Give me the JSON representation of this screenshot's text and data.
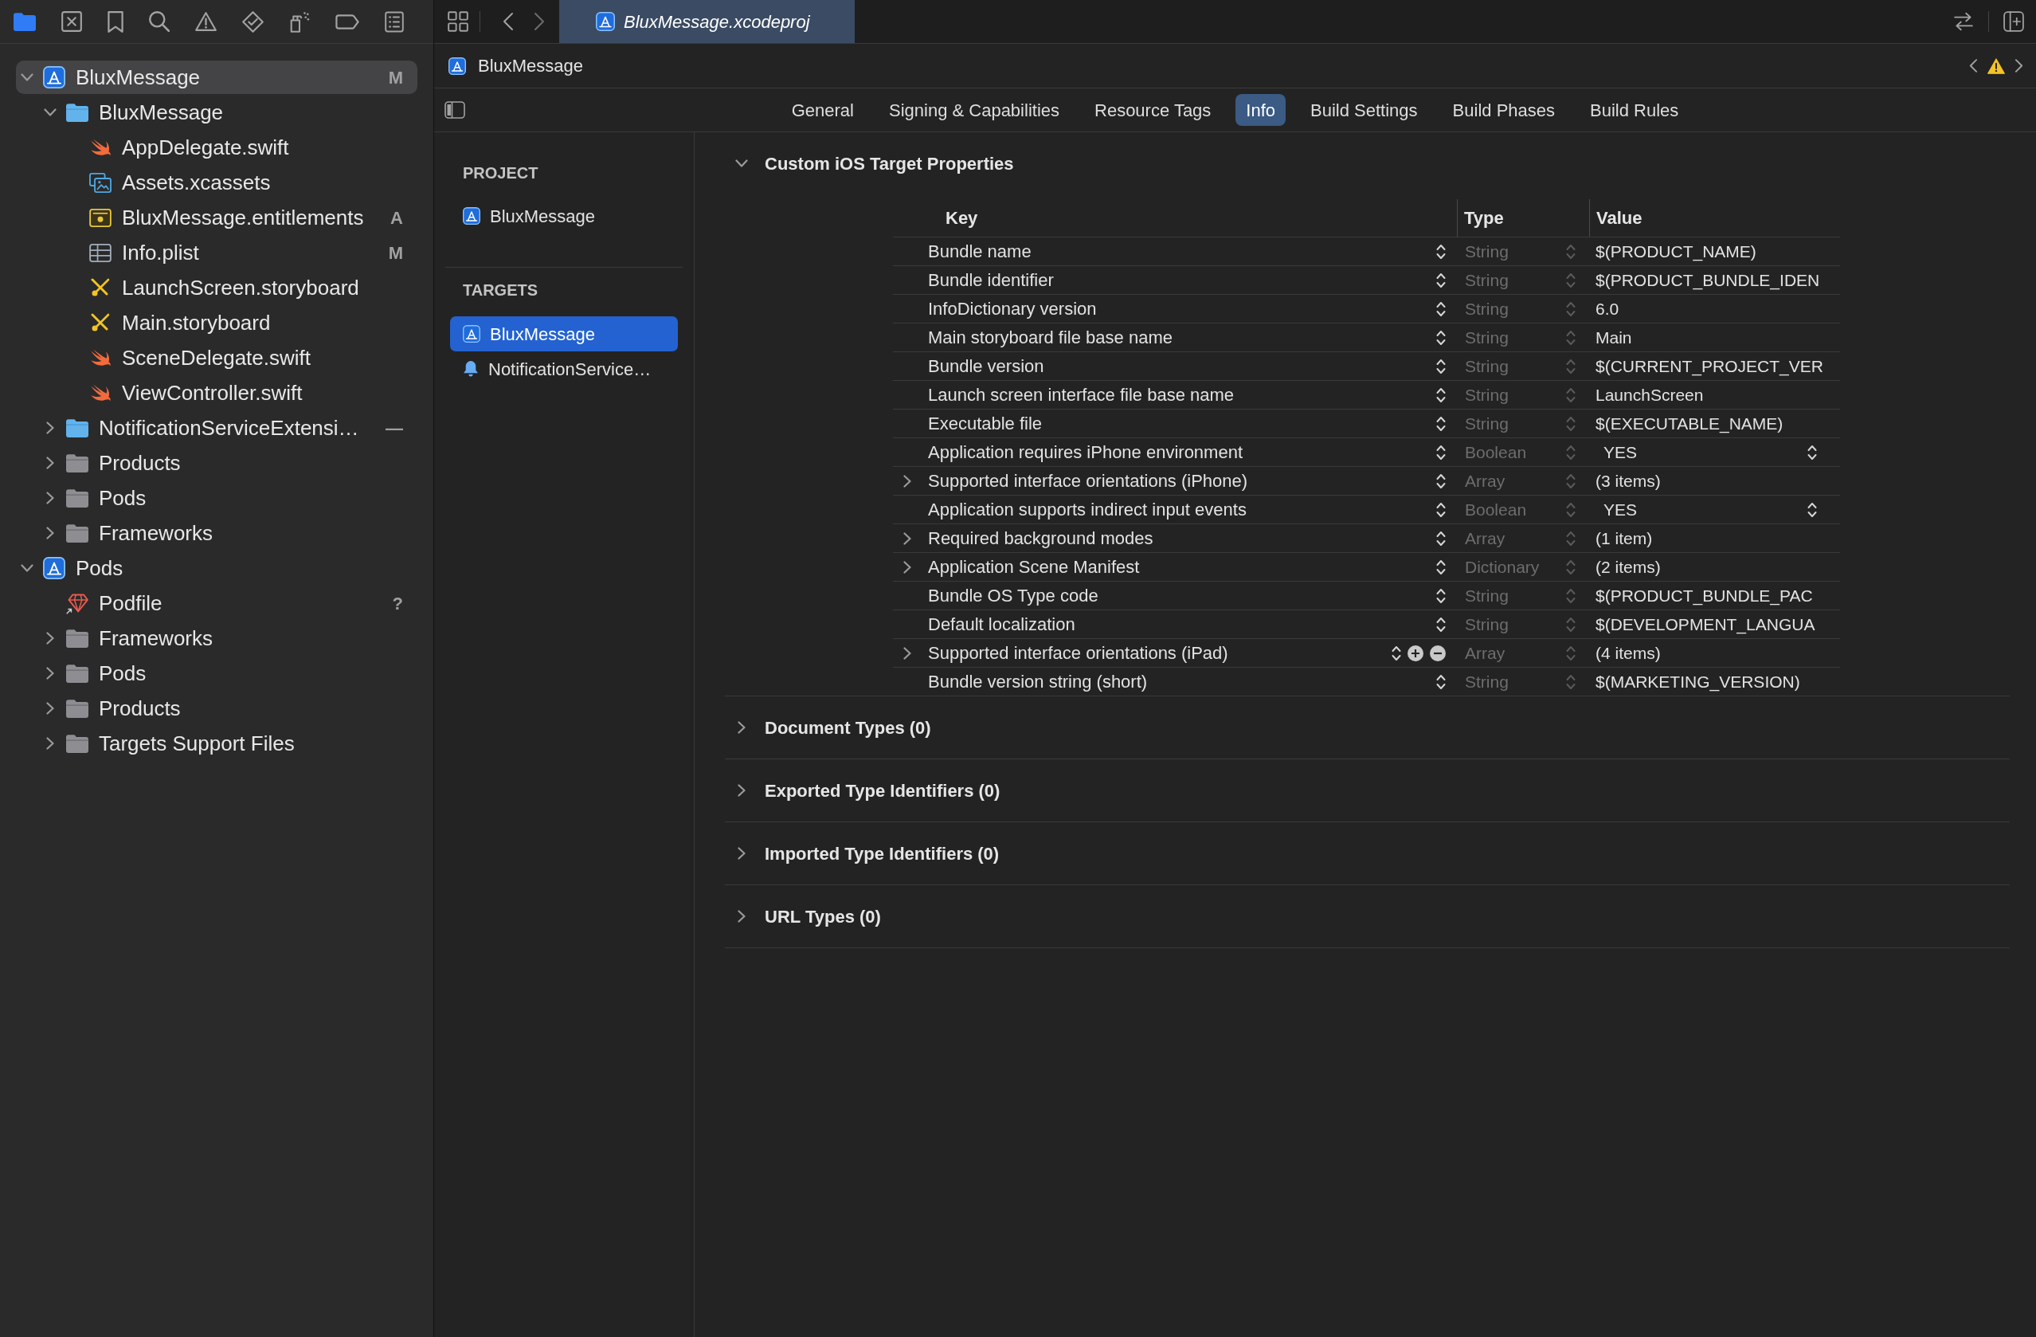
{
  "navigator": {
    "toolbar_tabs": [
      {
        "selected": true
      },
      {
        "selected": false
      },
      {
        "selected": false
      },
      {
        "selected": false
      },
      {
        "selected": false
      },
      {
        "selected": false
      },
      {
        "selected": false
      },
      {
        "selected": false
      },
      {
        "selected": false
      }
    ],
    "items": [
      {
        "label": "BluxMessage",
        "kind": "project",
        "expanded": true,
        "selected": true,
        "badge": "M",
        "children": [
          {
            "label": "BluxMessage",
            "kind": "folder",
            "expanded": true,
            "selected": false,
            "children": [
              {
                "label": "AppDelegate.swift",
                "kind": "swift",
                "selected": false
              },
              {
                "label": "Assets.xcassets",
                "kind": "assets",
                "selected": false
              },
              {
                "label": "BluxMessage.entitlements",
                "kind": "entitlements",
                "selected": false,
                "badge": "A"
              },
              {
                "label": "Info.plist",
                "kind": "plist",
                "selected": false,
                "badge": "M"
              },
              {
                "label": "LaunchScreen.storyboard",
                "kind": "storyboard",
                "selected": false
              },
              {
                "label": "Main.storyboard",
                "kind": "storyboard",
                "selected": false
              },
              {
                "label": "SceneDelegate.swift",
                "kind": "swift",
                "selected": false
              },
              {
                "label": "ViewController.swift",
                "kind": "swift",
                "selected": false
              }
            ]
          },
          {
            "label": "NotificationServiceExtensi…",
            "kind": "folder",
            "expanded": false,
            "selected": false,
            "badge": "—"
          },
          {
            "label": "Products",
            "kind": "group",
            "expanded": false,
            "selected": false
          },
          {
            "label": "Pods",
            "kind": "group",
            "expanded": false,
            "selected": false
          },
          {
            "label": "Frameworks",
            "kind": "group",
            "expanded": false,
            "selected": false
          }
        ]
      },
      {
        "label": "Pods",
        "kind": "project",
        "expanded": true,
        "selected": false,
        "children": [
          {
            "label": "Podfile",
            "kind": "gem",
            "selected": false,
            "badge": "?"
          },
          {
            "label": "Frameworks",
            "kind": "group",
            "expanded": false,
            "selected": false
          },
          {
            "label": "Pods",
            "kind": "group",
            "expanded": false,
            "selected": false
          },
          {
            "label": "Products",
            "kind": "group",
            "expanded": false,
            "selected": false
          },
          {
            "label": "Targets Support Files",
            "kind": "group",
            "expanded": false,
            "selected": false
          }
        ]
      }
    ]
  },
  "editor": {
    "tabs": [
      {
        "label": "BluxMessage.xcodeproj",
        "selected": true
      }
    ],
    "jump_bar": {
      "path": "BluxMessage"
    },
    "settings_tabs": [
      {
        "label": "General",
        "selected": false
      },
      {
        "label": "Signing & Capabilities",
        "selected": false
      },
      {
        "label": "Resource Tags",
        "selected": false
      },
      {
        "label": "Info",
        "selected": true
      },
      {
        "label": "Build Settings",
        "selected": false
      },
      {
        "label": "Build Phases",
        "selected": false
      },
      {
        "label": "Build Rules",
        "selected": false
      }
    ],
    "target_list": {
      "groups": [
        {
          "heading": "PROJECT",
          "items": [
            {
              "label": "BluxMessage",
              "kind": "app",
              "selected": false
            }
          ]
        },
        {
          "heading": "TARGETS",
          "items": [
            {
              "label": "BluxMessage",
              "kind": "app",
              "selected": true
            },
            {
              "label": "NotificationService…",
              "kind": "extension",
              "selected": false
            }
          ]
        }
      ]
    },
    "sections": [
      {
        "title": "Custom iOS Target Properties",
        "expanded": true,
        "table": {
          "columns": [
            "Key",
            "Type",
            "Value"
          ],
          "rows": [
            {
              "key": "Bundle name",
              "type": "String",
              "value": "$(PRODUCT_NAME)",
              "kind": "text",
              "hovered": false
            },
            {
              "key": "Bundle identifier",
              "type": "String",
              "value": "$(PRODUCT_BUNDLE_IDEN",
              "kind": "text",
              "hovered": false
            },
            {
              "key": "InfoDictionary version",
              "type": "String",
              "value": "6.0",
              "kind": "text",
              "hovered": false
            },
            {
              "key": "Main storyboard file base name",
              "type": "String",
              "value": "Main",
              "kind": "text",
              "hovered": false
            },
            {
              "key": "Bundle version",
              "type": "String",
              "value": "$(CURRENT_PROJECT_VER",
              "kind": "text",
              "hovered": false
            },
            {
              "key": "Launch screen interface file base name",
              "type": "String",
              "value": "LaunchScreen",
              "kind": "text",
              "hovered": false
            },
            {
              "key": "Executable file",
              "type": "String",
              "value": "$(EXECUTABLE_NAME)",
              "kind": "text",
              "hovered": false
            },
            {
              "key": "Application requires iPhone environment",
              "type": "Boolean",
              "value": "YES",
              "kind": "popup",
              "hovered": false
            },
            {
              "key": "Supported interface orientations (iPhone)",
              "type": "Array",
              "value": "(3 items)",
              "kind": "collection",
              "expanded": false,
              "hovered": false
            },
            {
              "key": "Application supports indirect input events",
              "type": "Boolean",
              "value": "YES",
              "kind": "popup",
              "hovered": false
            },
            {
              "key": "Required background modes",
              "type": "Array",
              "value": "(1 item)",
              "kind": "collection",
              "expanded": false,
              "hovered": false
            },
            {
              "key": "Application Scene Manifest",
              "type": "Dictionary",
              "value": "(2 items)",
              "kind": "collection",
              "expanded": false,
              "hovered": false
            },
            {
              "key": "Bundle OS Type code",
              "type": "String",
              "value": "$(PRODUCT_BUNDLE_PAC",
              "kind": "text",
              "hovered": false
            },
            {
              "key": "Default localization",
              "type": "String",
              "value": "$(DEVELOPMENT_LANGUA",
              "kind": "text",
              "hovered": false
            },
            {
              "key": "Supported interface orientations (iPad)",
              "type": "Array",
              "value": "(4 items)",
              "kind": "collection",
              "expanded": false,
              "hovered": true
            },
            {
              "key": "Bundle version string (short)",
              "type": "String",
              "value": "$(MARKETING_VERSION)",
              "kind": "text",
              "hovered": false
            }
          ]
        }
      },
      {
        "title": "Document Types (0)",
        "expanded": false
      },
      {
        "title": "Exported Type Identifiers (0)",
        "expanded": false
      },
      {
        "title": "Imported Type Identifiers (0)",
        "expanded": false
      },
      {
        "title": "URL Types (0)",
        "expanded": false
      }
    ]
  }
}
